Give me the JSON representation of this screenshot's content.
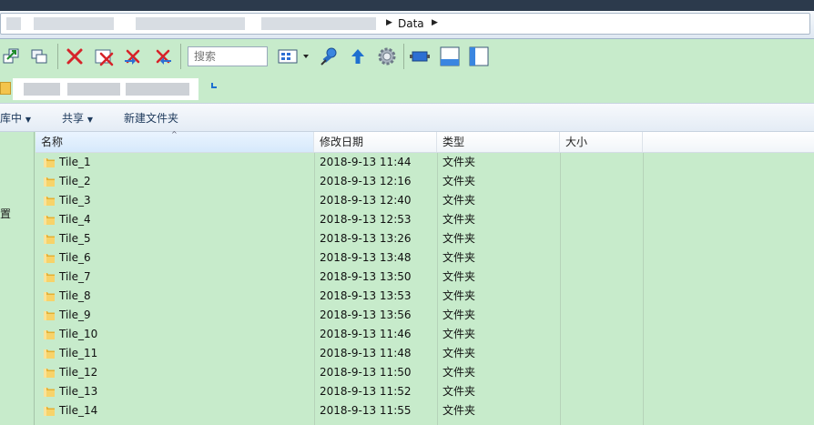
{
  "address": {
    "crumbs": [
      "Data"
    ]
  },
  "toolbar": {
    "search_placeholder": "搜索",
    "icons": [
      "restore-window-icon",
      "cascade-windows-icon",
      "delete-icon",
      "delete-window-icon",
      "delete-left-icon",
      "delete-right-icon",
      "view-menu-icon",
      "pin-icon",
      "up-arrow-icon",
      "settings-gear-icon",
      "screen-icon",
      "bottom-panel-icon",
      "side-panel-icon"
    ]
  },
  "nav": {
    "partial_label": "置"
  },
  "commands": {
    "library_label": "库中",
    "share_label": "共享",
    "new_folder_label": "新建文件夹"
  },
  "columns": {
    "name": "名称",
    "modified": "修改日期",
    "type": "类型",
    "size": "大小"
  },
  "files": [
    {
      "name": "Tile_1",
      "date": "2018-9-13 11:44",
      "type": "文件夹"
    },
    {
      "name": "Tile_2",
      "date": "2018-9-13 12:16",
      "type": "文件夹"
    },
    {
      "name": "Tile_3",
      "date": "2018-9-13 12:40",
      "type": "文件夹"
    },
    {
      "name": "Tile_4",
      "date": "2018-9-13 12:53",
      "type": "文件夹"
    },
    {
      "name": "Tile_5",
      "date": "2018-9-13 13:26",
      "type": "文件夹"
    },
    {
      "name": "Tile_6",
      "date": "2018-9-13 13:48",
      "type": "文件夹"
    },
    {
      "name": "Tile_7",
      "date": "2018-9-13 13:50",
      "type": "文件夹"
    },
    {
      "name": "Tile_8",
      "date": "2018-9-13 13:53",
      "type": "文件夹"
    },
    {
      "name": "Tile_9",
      "date": "2018-9-13 13:56",
      "type": "文件夹"
    },
    {
      "name": "Tile_10",
      "date": "2018-9-13 11:46",
      "type": "文件夹"
    },
    {
      "name": "Tile_11",
      "date": "2018-9-13 11:48",
      "type": "文件夹"
    },
    {
      "name": "Tile_12",
      "date": "2018-9-13 11:50",
      "type": "文件夹"
    },
    {
      "name": "Tile_13",
      "date": "2018-9-13 11:52",
      "type": "文件夹"
    },
    {
      "name": "Tile_14",
      "date": "2018-9-13 11:55",
      "type": "文件夹"
    }
  ],
  "colors": {
    "background": "#c7ebcb",
    "accent": "#1e6fd0",
    "delete_red": "#d6232a",
    "folder_yellow": "#f3c44c"
  }
}
